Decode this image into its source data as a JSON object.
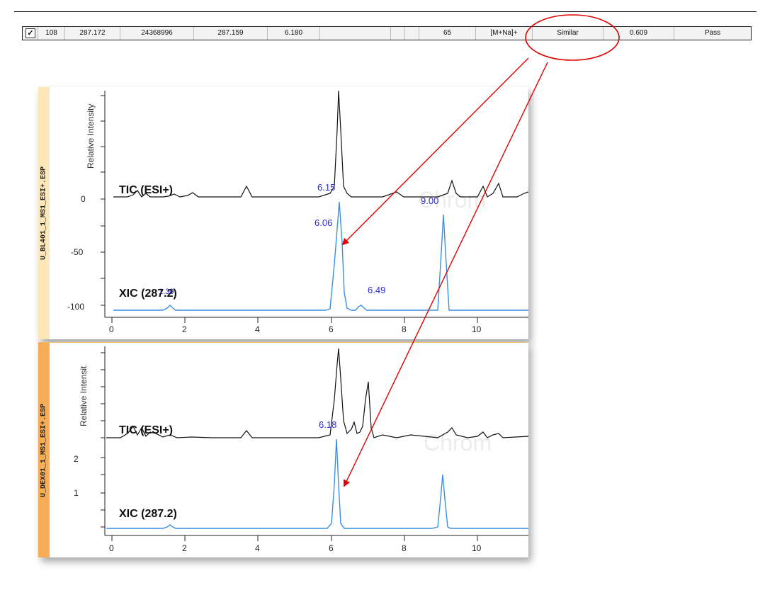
{
  "table_row": {
    "checked": "☑",
    "checkbox_mark": "✓",
    "cells": [
      "108",
      "287.172",
      "24368996",
      "287.159",
      "6.180",
      "",
      "",
      "",
      "65",
      "[M+Na]+",
      "Similar",
      "0.609",
      "Pass"
    ]
  },
  "panel_top": {
    "sample_label": "U_BL401_1_MS1_ESI+.ESP",
    "y_axis_label": "Relative Intensity",
    "y_ticks": [
      "0",
      "-50",
      "-100"
    ],
    "x_ticks": [
      "0",
      "2",
      "4",
      "6",
      "8",
      "10"
    ],
    "tic_label": "TIC (ESI+)",
    "xic_label": "XIC (287.2)",
    "peak_labels": [
      "6.15",
      "6.06",
      "6.49",
      "9.00",
      "1.30"
    ],
    "watermark": "Chrom"
  },
  "panel_bottom": {
    "sample_label": "U_DEX01_1_MS1_ESI+.ESP",
    "y_axis_label": "Relative Intensit",
    "y_ticks": [
      "2",
      "1"
    ],
    "x_ticks": [
      "0",
      "2",
      "4",
      "6",
      "8",
      "10"
    ],
    "tic_label": "TIC (ESI+)",
    "xic_label": "XIC (287.2)",
    "peak_labels": [
      "6.18"
    ],
    "watermark": "Chrom"
  },
  "colors": {
    "tic": "#111111",
    "xic": "#3b8fe0",
    "peak_label": "#2a2ae0",
    "arrow": "#e00000",
    "panel1_tab": "#fde7b8",
    "panel2_tab": "#f6ad56"
  }
}
